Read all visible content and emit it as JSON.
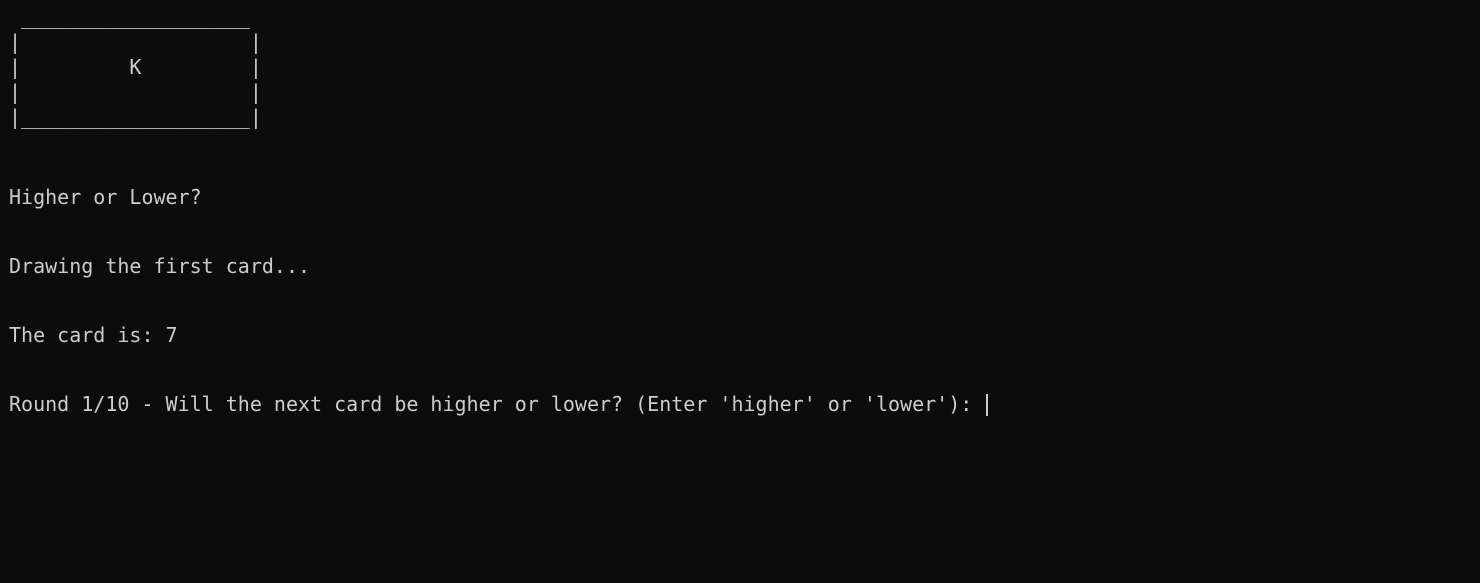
{
  "terminal": {
    "card_art": [
      " ___________________",
      "|                   |",
      "|         K         |",
      "|                   |",
      "|___________________|"
    ],
    "lines": [
      "Higher or Lower?",
      "Drawing the first card...",
      "The card is: 7"
    ],
    "prompt": "Round 1/10 - Will the next card be higher or lower? (Enter 'higher' or 'lower'): ",
    "input_value": ""
  },
  "colors": {
    "background": "#0c0c0c",
    "foreground": "#cccccc"
  }
}
